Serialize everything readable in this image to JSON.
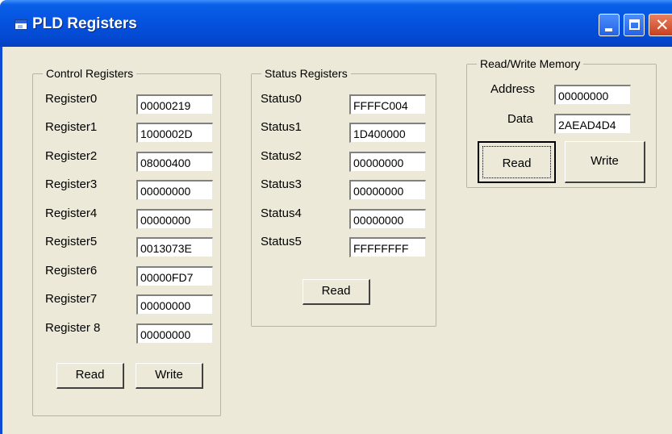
{
  "window": {
    "title": "PLD Registers"
  },
  "control": {
    "legend": "Control Registers",
    "registers": [
      {
        "label": "Register0",
        "value": "00000219"
      },
      {
        "label": "Register1",
        "value": "1000002D"
      },
      {
        "label": "Register2",
        "value": "08000400"
      },
      {
        "label": "Register3",
        "value": "00000000"
      },
      {
        "label": "Register4",
        "value": "00000000"
      },
      {
        "label": "Register5",
        "value": "0013073E"
      },
      {
        "label": "Register6",
        "value": "00000FD7"
      },
      {
        "label": "Register7",
        "value": "00000000"
      },
      {
        "label": "Register 8",
        "value": "00000000"
      }
    ],
    "read_label": "Read",
    "write_label": "Write"
  },
  "status": {
    "legend": "Status Registers",
    "registers": [
      {
        "label": "Status0",
        "value": "FFFFC004"
      },
      {
        "label": "Status1",
        "value": "1D400000"
      },
      {
        "label": "Status2",
        "value": "00000000"
      },
      {
        "label": "Status3",
        "value": "00000000"
      },
      {
        "label": "Status4",
        "value": "00000000"
      },
      {
        "label": "Status5",
        "value": "FFFFFFFF"
      }
    ],
    "read_label": "Read"
  },
  "memory": {
    "legend": "Read/Write Memory",
    "address_label": "Address",
    "address_value": "00000000",
    "data_label": "Data",
    "data_value": "2AEAD4D4",
    "read_label": "Read",
    "write_label": "Write"
  }
}
